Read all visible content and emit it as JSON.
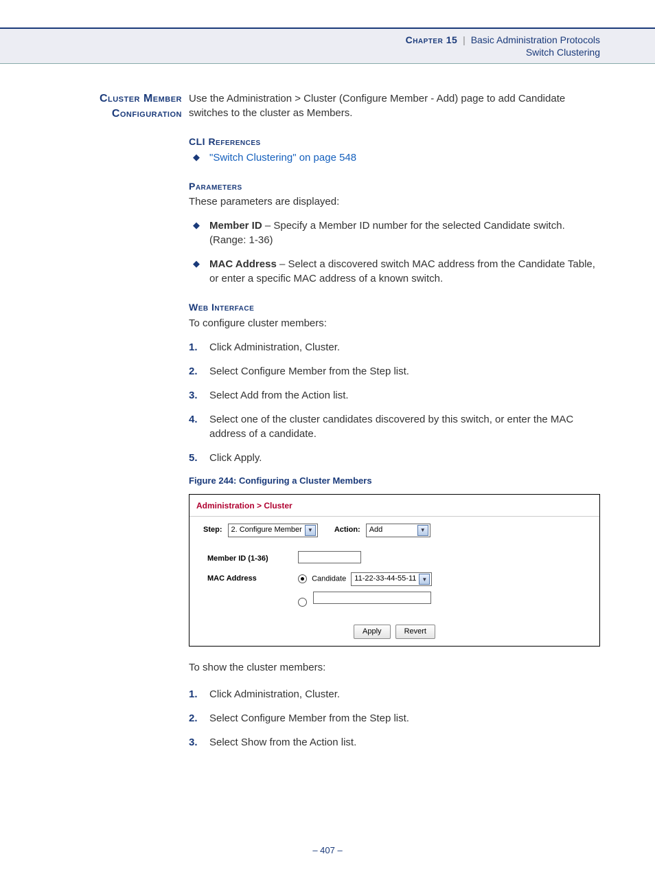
{
  "header": {
    "chapter_label": "Chapter 15",
    "separator": "|",
    "title": "Basic Administration Protocols",
    "subtitle": "Switch Clustering"
  },
  "section_title_line1": "Cluster Member",
  "section_title_line2": "Configuration",
  "intro_text": "Use the Administration > Cluster (Configure Member - Add) page to add Candidate switches to the cluster as Members.",
  "cli_ref": {
    "heading": "CLI References",
    "link_text": "\"Switch Clustering\" on page 548"
  },
  "parameters": {
    "heading": "Parameters",
    "intro": "These parameters are displayed:",
    "items": [
      {
        "bold": "Member ID",
        "rest": " – Specify a Member ID number for the selected Candidate switch. (Range: 1-36)"
      },
      {
        "bold": "MAC Address",
        "rest": " – Select a discovered switch MAC address from the Candidate Table, or enter a specific MAC address of a known switch."
      }
    ]
  },
  "web_if": {
    "heading": "Web Interface",
    "intro": "To configure cluster members:",
    "steps": [
      "Click Administration, Cluster.",
      "Select Configure Member from the Step list.",
      "Select Add from the Action list.",
      "Select one of the cluster candidates discovered by this switch, or enter the MAC address of a candidate.",
      "Click Apply."
    ]
  },
  "figure_caption": "Figure 244:  Configuring a Cluster Members",
  "ui": {
    "breadcrumb": "Administration > Cluster",
    "step_label": "Step:",
    "step_value": "2. Configure Member",
    "action_label": "Action:",
    "action_value": "Add",
    "member_id_label": "Member ID (1-36)",
    "mac_label": "MAC Address",
    "candidate_label": "Candidate",
    "candidate_value": "11-22-33-44-55-11",
    "apply_label": "Apply",
    "revert_label": "Revert"
  },
  "show_section": {
    "intro": "To show the cluster members:",
    "steps": [
      "Click Administration, Cluster.",
      "Select Configure Member from the Step list.",
      "Select Show from the Action list."
    ]
  },
  "page_number": "–  407  –"
}
